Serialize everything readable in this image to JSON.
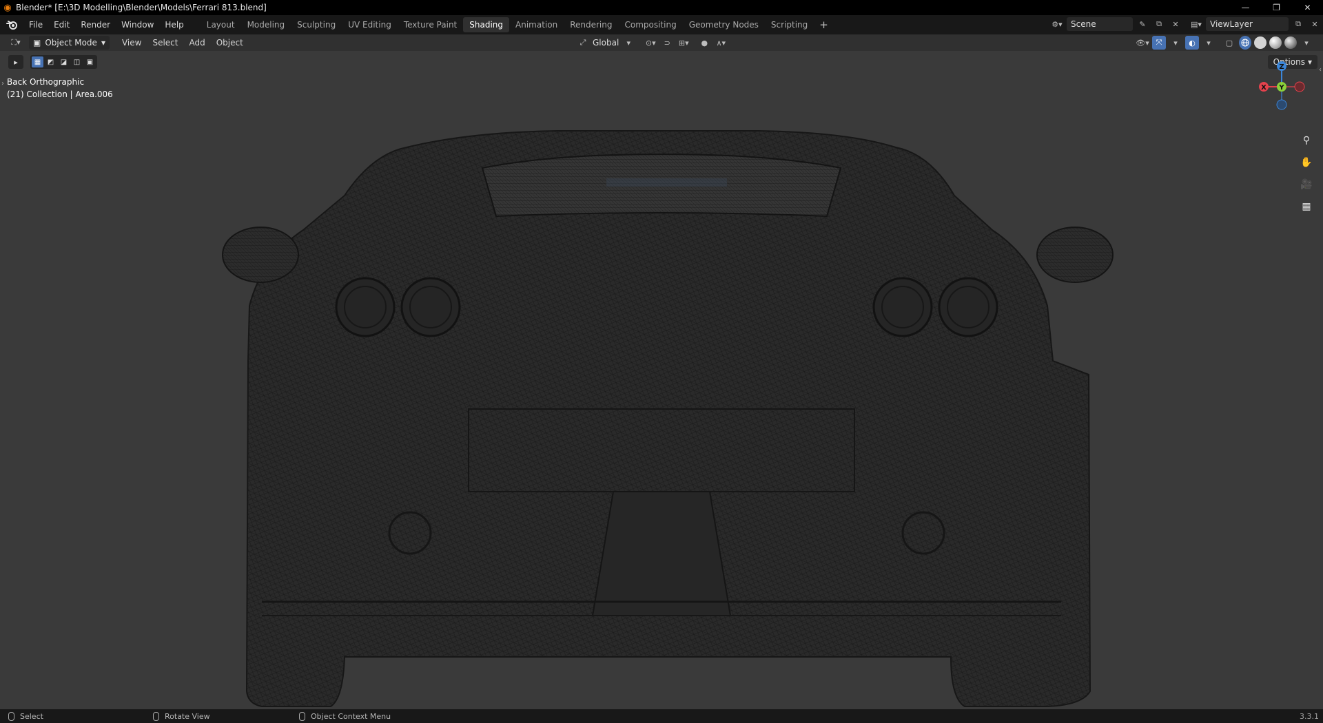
{
  "window": {
    "title": "Blender* [E:\\3D Modelling\\Blender\\Models\\Ferrari 813.blend]",
    "minimize": "—",
    "restore": "❐",
    "close": "✕"
  },
  "menu": {
    "items": [
      "File",
      "Edit",
      "Render",
      "Window",
      "Help"
    ]
  },
  "workspaces": {
    "tabs": [
      "Layout",
      "Modeling",
      "Sculpting",
      "UV Editing",
      "Texture Paint",
      "Shading",
      "Animation",
      "Rendering",
      "Compositing",
      "Geometry Nodes",
      "Scripting"
    ],
    "active": "Shading",
    "add": "+"
  },
  "scene": {
    "value": "Scene",
    "view_layer": "ViewLayer"
  },
  "viewport_header": {
    "mode": "Object Mode",
    "menus": [
      "View",
      "Select",
      "Add",
      "Object"
    ],
    "transform_orientation": "Global"
  },
  "viewport": {
    "view_name": "Back Orthographic",
    "collection_info": "(21) Collection | Area.006",
    "options_label": "Options",
    "gizmo": {
      "z": "Z",
      "y": "Y",
      "x": "X"
    }
  },
  "statusbar": {
    "select": "Select",
    "rotate": "Rotate View",
    "context": "Object Context Menu",
    "version": "3.3.1"
  },
  "colors": {
    "accent": "#4772b3",
    "viewport_bg": "#3a3a3a",
    "x_axis": "#e5424d",
    "y_axis": "#8bd13a",
    "z_axis": "#3b86d9",
    "active_tab": "#303030"
  }
}
